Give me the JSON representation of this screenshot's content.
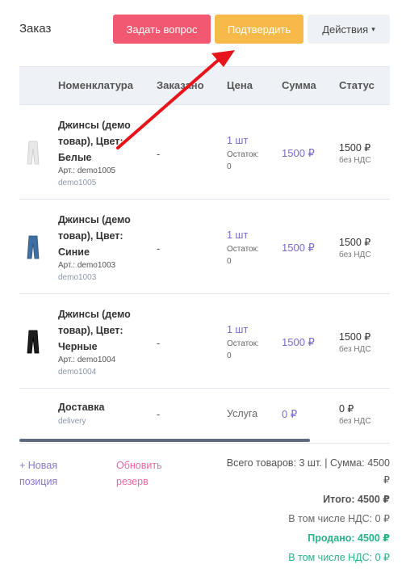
{
  "header": {
    "title": "Заказ",
    "ask_label": "Задать вопрос",
    "confirm_label": "Подтвердить",
    "actions_label": "Действия",
    "actions_chevron": "▾"
  },
  "columns": [
    "Номенклатура",
    "Заказано",
    "Цена",
    "Сумма",
    "Статус"
  ],
  "rows": [
    {
      "name": "Джинсы (демо товар), Цвет: Белые",
      "article": "Арт.: demo1005",
      "code": "demo1005",
      "ordered": "-",
      "qty": "1 шт",
      "stock_label": "Остаток:",
      "stock_value": "0",
      "sum": "1500 ₽",
      "status": "1500 ₽",
      "vat": "без НДС",
      "thumb": "jeans-white",
      "thumb_color": "#e8e8e8"
    },
    {
      "name": "Джинсы (демо товар), Цвет: Синие",
      "article": "Арт.: demo1003",
      "code": "demo1003",
      "ordered": "-",
      "qty": "1 шт",
      "stock_label": "Остаток:",
      "stock_value": "0",
      "sum": "1500 ₽",
      "status": "1500 ₽",
      "vat": "без НДС",
      "thumb": "jeans-blue",
      "thumb_color": "#3f6ea3"
    },
    {
      "name": "Джинсы (демо товар), Цвет: Черные",
      "article": "Арт.: demo1004",
      "code": "demo1004",
      "ordered": "-",
      "qty": "1 шт",
      "stock_label": "Остаток:",
      "stock_value": "0",
      "sum": "1500 ₽",
      "status": "1500 ₽",
      "vat": "без НДС",
      "thumb": "jeans-black",
      "thumb_color": "#1c1c1c"
    },
    {
      "name": "Доставка",
      "code": "delivery",
      "ordered": "-",
      "qty": "Услуга",
      "sum": "0 ₽",
      "status": "0 ₽",
      "vat": "без НДС"
    }
  ],
  "footer": {
    "new_position": "+ Новая позиция",
    "refresh_reserve": "Обновить резерв",
    "total_goods_line1": "Всего товаров: 3 шт. | Сумма: 4500",
    "total_goods_line2": "₽",
    "total": "Итого: 4500 ₽",
    "total_vat": "В том числе НДС: 0 ₽",
    "sold": "Продано: 4500 ₽",
    "sold_vat": "В том числе НДС: 0 ₽"
  },
  "colors": {
    "ask_button": "#f2586f",
    "confirm_button": "#f8b94b",
    "sold_text": "#27b389",
    "arrow": "#e8141c"
  }
}
